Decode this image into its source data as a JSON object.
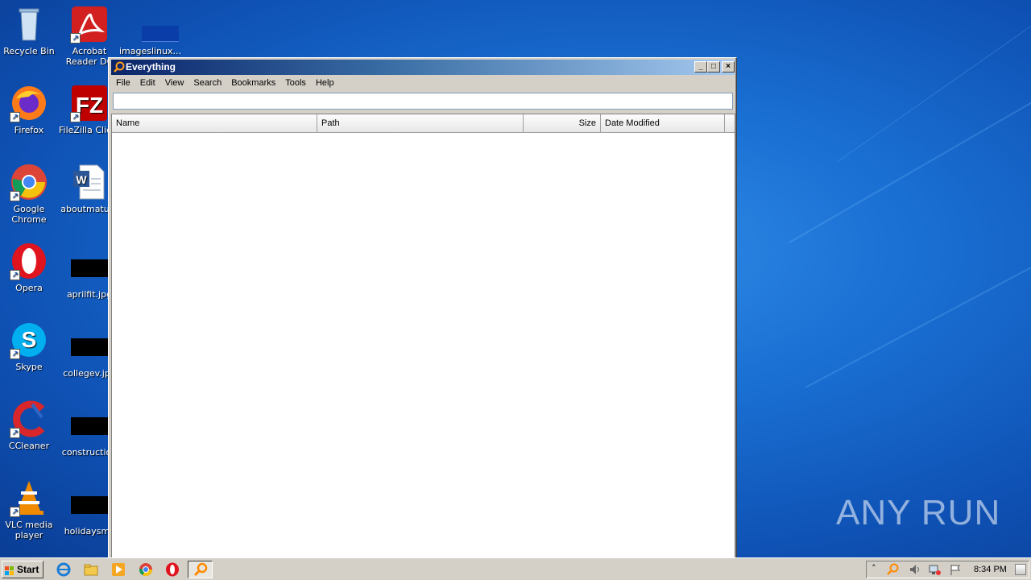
{
  "desktop": {
    "icons": [
      {
        "label": "Recycle Bin"
      },
      {
        "label": "Acrobat Reader DC"
      },
      {
        "label": "imageslinux...."
      },
      {
        "label": "Firefox"
      },
      {
        "label": "FileZilla Client"
      },
      {
        "label": "Google Chrome"
      },
      {
        "label": "aboutmature"
      },
      {
        "label": "Opera"
      },
      {
        "label": "aprilfit.jpg"
      },
      {
        "label": "Skype"
      },
      {
        "label": "collegev.jpg"
      },
      {
        "label": "CCleaner"
      },
      {
        "label": "construction"
      },
      {
        "label": "VLC media player"
      },
      {
        "label": "holidaysmil"
      }
    ]
  },
  "window": {
    "title": "Everything",
    "menu": [
      "File",
      "Edit",
      "View",
      "Search",
      "Bookmarks",
      "Tools",
      "Help"
    ],
    "search": {
      "value": "",
      "placeholder": ""
    },
    "columns": [
      "Name",
      "Path",
      "Size",
      "Date Modified"
    ]
  },
  "taskbar": {
    "start_label": "Start",
    "clock": "8:34 PM"
  },
  "watermark": "ANY RUN"
}
